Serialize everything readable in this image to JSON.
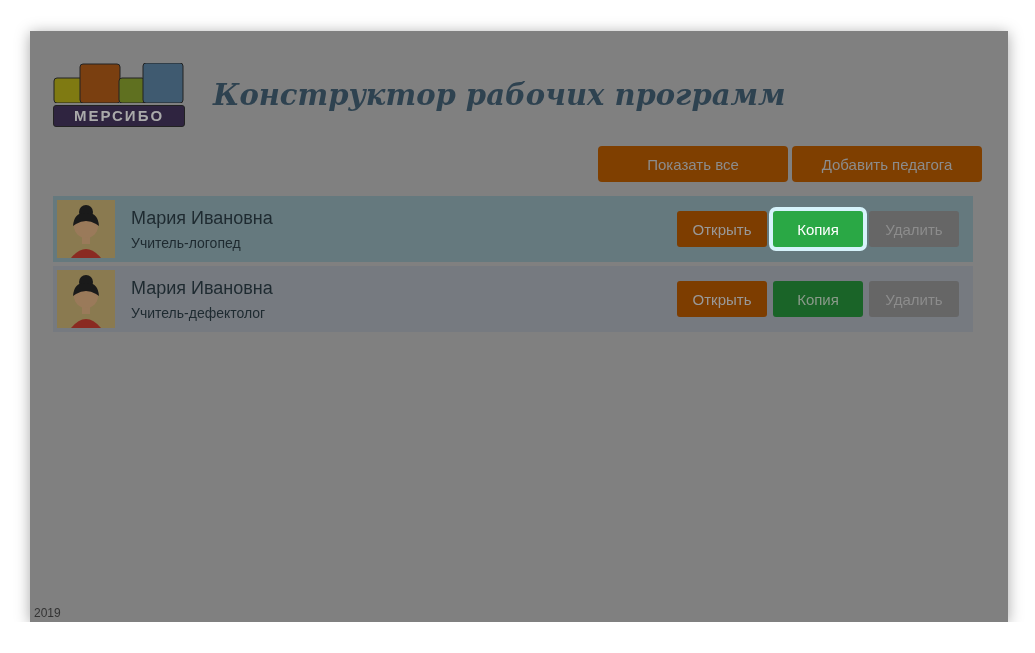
{
  "logo": {
    "text": "МЕРСИБО"
  },
  "title": "Конструктор рабочих программ",
  "actions": [
    "Показать все",
    "Добавить педагога"
  ],
  "teachers": [
    {
      "name": "Мария Ивановна",
      "role": "Учитель-логопед",
      "selected": true,
      "buttons": [
        {
          "label": "Открыть",
          "kind": "open",
          "highlighted": false
        },
        {
          "label": "Копия",
          "kind": "copy",
          "highlighted": true
        },
        {
          "label": "Удалить",
          "kind": "delete",
          "highlighted": false
        }
      ]
    },
    {
      "name": "Мария Ивановна",
      "role": "Учитель-дефектолог",
      "selected": false,
      "buttons": [
        {
          "label": "Открыть",
          "kind": "open",
          "highlighted": false
        },
        {
          "label": "Копия",
          "kind": "copy",
          "highlighted": false
        },
        {
          "label": "Удалить",
          "kind": "delete",
          "highlighted": false
        }
      ]
    }
  ],
  "footer": "2019"
}
